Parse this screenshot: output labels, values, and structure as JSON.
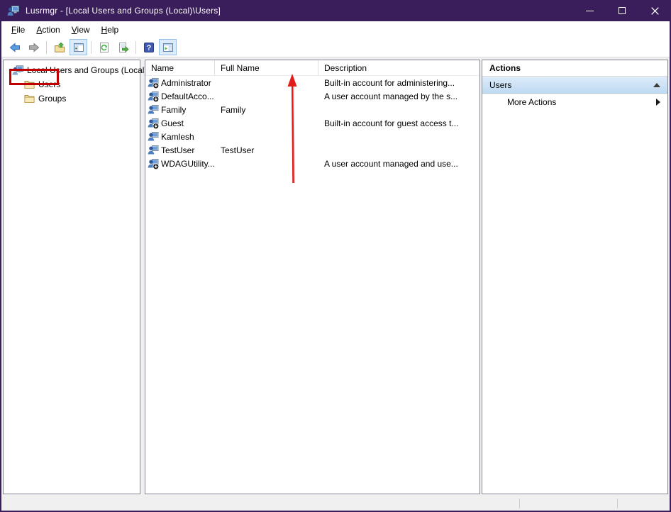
{
  "window": {
    "title": "Lusrmgr - [Local Users and Groups (Local)\\Users]",
    "titlebar_color": "#3a1d5b"
  },
  "menubar": {
    "items": [
      {
        "label": "File"
      },
      {
        "label": "Action"
      },
      {
        "label": "View"
      },
      {
        "label": "Help"
      }
    ]
  },
  "toolbar": {
    "buttons": [
      {
        "name": "back",
        "toggled": false
      },
      {
        "name": "forward",
        "toggled": false
      },
      {
        "name": "up-one-level",
        "toggled": false
      },
      {
        "name": "show-console-tree",
        "toggled": true
      },
      {
        "name": "refresh",
        "toggled": false
      },
      {
        "name": "export-list",
        "toggled": false
      },
      {
        "name": "help",
        "toggled": false
      },
      {
        "name": "show-action-pane",
        "toggled": true
      }
    ]
  },
  "icons": {
    "help_glyph": "?"
  },
  "tree": {
    "root": "Local Users and Groups (Local)",
    "items": [
      {
        "label": "Users",
        "annotated": true
      },
      {
        "label": "Groups",
        "annotated": false
      }
    ]
  },
  "list": {
    "columns": [
      "Name",
      "Full Name",
      "Description"
    ],
    "rows": [
      {
        "name": "Administrator",
        "full_name": "",
        "description": "Built-in account for administering...",
        "disabled": true
      },
      {
        "name": "DefaultAcco...",
        "full_name": "",
        "description": "A user account managed by the s...",
        "disabled": true
      },
      {
        "name": "Family",
        "full_name": "Family",
        "description": "",
        "disabled": false
      },
      {
        "name": "Guest",
        "full_name": "",
        "description": "Built-in account for guest access t...",
        "disabled": true
      },
      {
        "name": "Kamlesh",
        "full_name": "",
        "description": "",
        "disabled": false
      },
      {
        "name": "TestUser",
        "full_name": "TestUser",
        "description": "",
        "disabled": false
      },
      {
        "name": "WDAGUtility...",
        "full_name": "",
        "description": "A user account managed and use...",
        "disabled": true
      }
    ]
  },
  "actions": {
    "title": "Actions",
    "section": "Users",
    "items": [
      {
        "label": "More Actions"
      }
    ]
  },
  "annotations": {
    "highlight_box_color": "#c00000",
    "arrow_color": "#e31b1b"
  }
}
